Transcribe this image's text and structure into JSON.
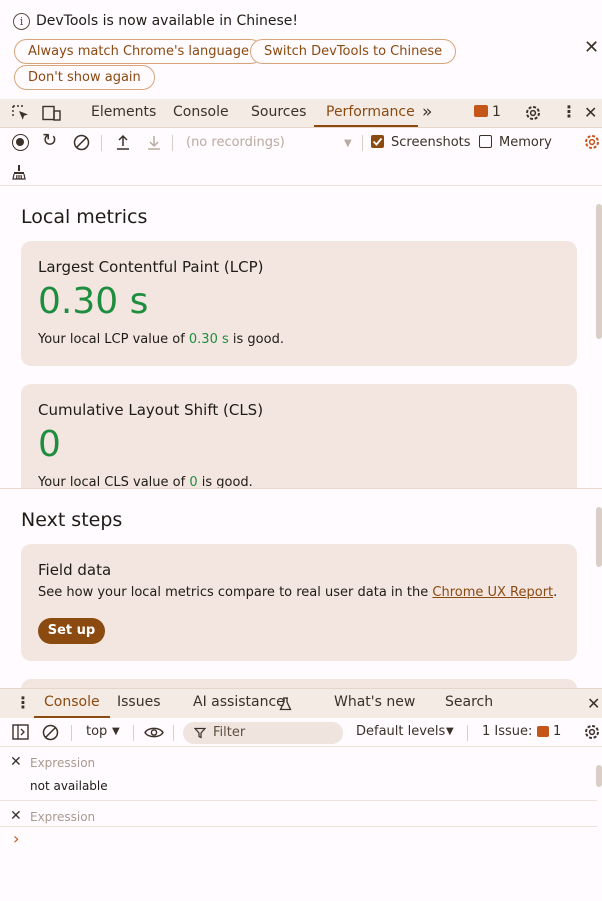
{
  "infobar": {
    "message": "DevTools is now available in Chinese!",
    "buttons": [
      "Always match Chrome's language",
      "Switch DevTools to Chinese",
      "Don't show again"
    ]
  },
  "tabs": {
    "items": [
      "Elements",
      "Console",
      "Sources",
      "Performance"
    ],
    "active": "Performance",
    "issues_count": "1"
  },
  "perf_toolbar": {
    "recordings_placeholder": "(no recordings)",
    "screenshots_label": "Screenshots",
    "screenshots_checked": true,
    "memory_label": "Memory",
    "memory_checked": false
  },
  "local_metrics": {
    "heading": "Local metrics",
    "lcp": {
      "title": "Largest Contentful Paint (LCP)",
      "value": "0.30 s",
      "desc_prefix": "Your local LCP value of ",
      "desc_value": "0.30 s",
      "desc_suffix": " is good."
    },
    "cls": {
      "title": "Cumulative Layout Shift (CLS)",
      "value": "0",
      "desc_prefix": "Your local CLS value of ",
      "desc_value": "0",
      "desc_suffix": " is good."
    }
  },
  "next_steps": {
    "heading": "Next steps",
    "field_data": {
      "title": "Field data",
      "desc_prefix": "See how your local metrics compare to real user data in the ",
      "link": "Chrome UX Report",
      "desc_suffix": ".",
      "button": "Set up"
    }
  },
  "drawer": {
    "tabs": [
      "Console",
      "Issues",
      "AI assistance",
      "What's new",
      "Search"
    ],
    "active": "Console",
    "context": "top",
    "filter_placeholder": "Filter",
    "levels": "Default levels",
    "issues_label": "1 Issue:",
    "issues_count": "1",
    "expressions": [
      {
        "label": "Expression",
        "value": "not available"
      },
      {
        "label": "Expression",
        "value": ""
      }
    ],
    "prompt": "›"
  },
  "colors": {
    "accent": "#8a4a10",
    "good": "#1e8e3e",
    "card_bg": "#f3e6e1",
    "tabbar_bg": "#f5ebe5"
  }
}
